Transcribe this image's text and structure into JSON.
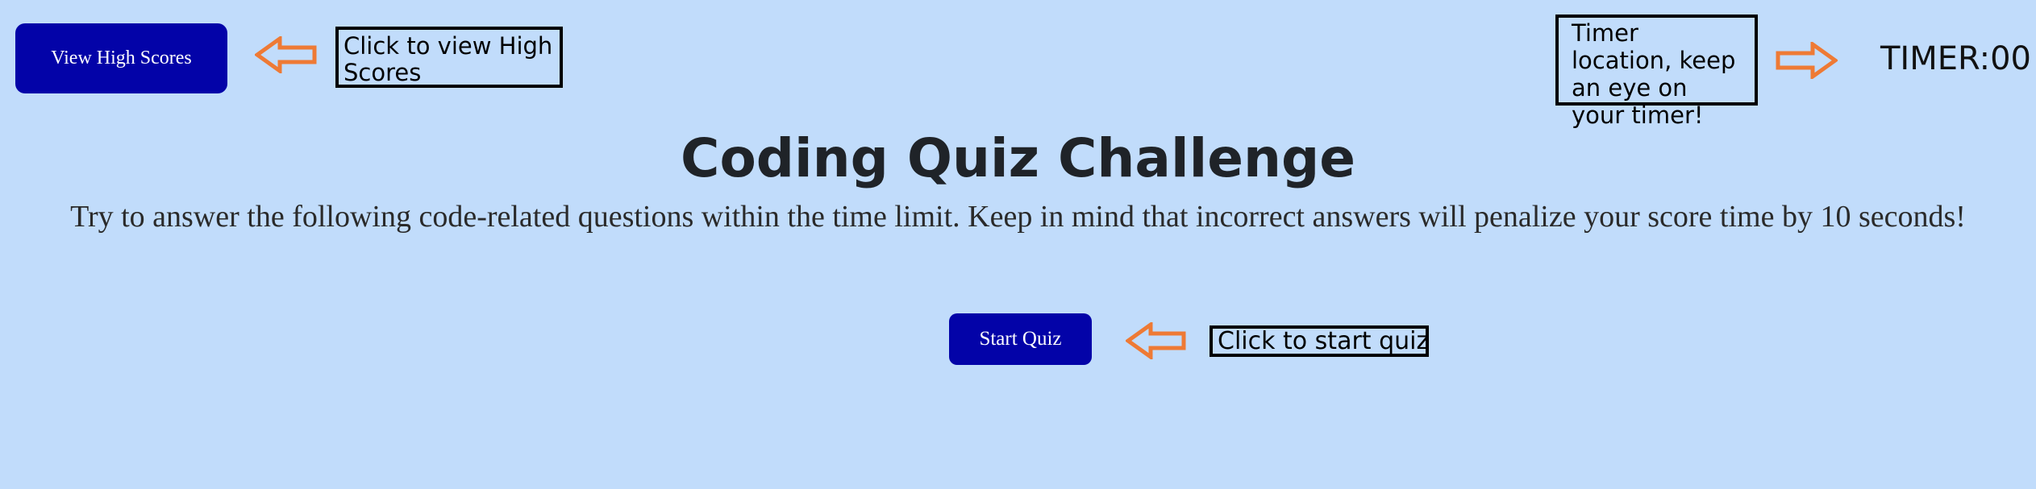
{
  "header": {
    "high_scores_button": "View High Scores",
    "high_scores_hint": "Click to view High Scores",
    "timer_hint": "Timer location, keep an eye on your timer!",
    "timer_label": "TIMER:",
    "timer_value": "00"
  },
  "main": {
    "title": "Coding Quiz Challenge",
    "description": "Try to answer the following code-related questions within the time limit. Keep in mind that incorrect answers will penalize your score time by 10 seconds!",
    "start_button": "Start Quiz",
    "start_hint": "Click to start quiz"
  },
  "icons": {
    "high_scores_arrow": "arrow-left-icon",
    "timer_arrow": "arrow-right-icon",
    "start_arrow": "arrow-left-icon"
  },
  "colors": {
    "background": "#c1dcfb",
    "button": "#0303a8",
    "arrow": "#ee7a35"
  }
}
